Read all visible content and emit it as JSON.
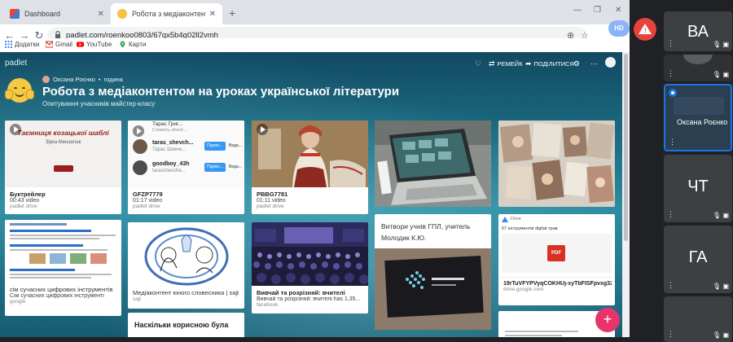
{
  "browser": {
    "tabs": [
      {
        "title": "Dashboard",
        "active": false
      },
      {
        "title": "Робота з медіаконтентом на ур",
        "active": true
      }
    ],
    "url": "padlet.com/roenkoo0803/67qx5b4g02ll2vmh",
    "bookmarks": [
      {
        "label": "Додатки"
      },
      {
        "label": "Gmail"
      },
      {
        "label": "YouTube"
      },
      {
        "label": "Карти"
      }
    ]
  },
  "padlet": {
    "logo": "padlet",
    "author": "Оксана Роєнко",
    "time_ago": "година",
    "title": "Робота з медіаконтентом на уроках української літератури",
    "subtitle": "Опитування учасників майстер-класу",
    "toolbar": {
      "remake": "РЕМЕЙК",
      "share": "ПОДІЛИТИСЯ"
    },
    "fab_label": "+",
    "cards": {
      "booktrailer": {
        "thumb_title": "Таємниця козацької шаблі",
        "thumb_author": "Зірка Мензатюк",
        "title": "Буктрейлер",
        "meta": "00:43 video",
        "source": "padlet drive"
      },
      "gfzp": {
        "rows": [
          {
            "name": "Тарас Григ...",
            "sub": "Стовпіть shech...",
            "btn": "",
            "more": ""
          },
          {
            "name": "taras_shevch...",
            "sub": "Тарас Шевче...",
            "btn": "Підпис...",
            "more": "Вида..."
          },
          {
            "name": "goodboy_43h",
            "sub": "tarasshevche...",
            "btn": "Підпис...",
            "more": "Вида..."
          }
        ],
        "title": "GFZP7779",
        "meta": "01:17 video",
        "source": "padlet drive"
      },
      "pbbg": {
        "title": "PBBG7781",
        "meta": "01:11 video",
        "source": "padlet drive"
      },
      "digital_tools": {
        "title": "сім сучасних цифрових інструментів",
        "desc": "Сім сучасних цифрових інструменті",
        "source": "google"
      },
      "mediacontent": {
        "title": "Медіаконтент юного словесника | sajt",
        "source": "sajt"
      },
      "teachers": {
        "title": "Вивчай та розрізняй: вчителі",
        "desc": "Вивчай та розрізняй: вчителі has 1,35...",
        "source": "facebook"
      },
      "students": {
        "text": "Витвори учнів ГПЛ, учитель Молодик К.Ю."
      },
      "drive_pdf": {
        "header": "Drive",
        "doc_title": "57 інструментів digital-трав",
        "badge": "PDF",
        "title": "19rTuVFYPVyqCOKHUj-xyTbFISFpvxg32",
        "source": "drive.google.com"
      },
      "useful": {
        "title": "Наскільки корисною була"
      }
    }
  },
  "meeting": {
    "hd_label": "HD",
    "participants": [
      {
        "initials": "ВА",
        "name": ""
      },
      {
        "initials": "",
        "name": ""
      },
      {
        "initials": "",
        "name": "Оксана Роєнко"
      },
      {
        "initials": "ЧТ",
        "name": ""
      },
      {
        "initials": "ГА",
        "name": ""
      },
      {
        "initials": "",
        "name": ""
      }
    ]
  }
}
